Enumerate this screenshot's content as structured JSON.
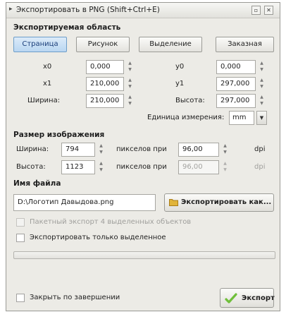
{
  "window": {
    "title": "Экспортировать в PNG (Shift+Ctrl+E)"
  },
  "export_area": {
    "heading": "Экспортируемая область",
    "tabs": [
      {
        "label": "Страница",
        "active": true
      },
      {
        "label": "Рисунок",
        "active": false
      },
      {
        "label": "Выделение",
        "active": false
      },
      {
        "label": "Заказная",
        "active": false
      }
    ],
    "x0_label": "x0",
    "x0_value": "0,000",
    "y0_label": "y0",
    "y0_value": "0,000",
    "x1_label": "x1",
    "x1_value": "210,000",
    "y1_label": "y1",
    "y1_value": "297,000",
    "width_label": "Ширина:",
    "width_value": "210,000",
    "height_label": "Высота:",
    "height_value": "297,000",
    "units_label": "Единица измерения:",
    "units_value": "mm"
  },
  "image_size": {
    "heading": "Размер изображения",
    "width_label": "Ширина:",
    "width_value": "794",
    "height_label": "Высота:",
    "height_value": "1123",
    "pixels_at_label": "пикселов при",
    "dpi_value": "96,00",
    "dpi_value_dim": "96,00",
    "dpi_label": "dpi"
  },
  "filename": {
    "heading": "Имя файла",
    "value": "D:\\Логотип Давыдова.png",
    "export_as_label": "Экспортировать как..."
  },
  "options": {
    "batch_label": "Пакетный экспорт 4 выделенных объектов",
    "only_selected_label": "Экспортировать только выделенное",
    "close_label": "Закрыть по завершении"
  },
  "progress_value": 0.0,
  "export_button_label": "Экспорт",
  "colors": {
    "active_tab": "#b9d6f1",
    "export_icon": "#6fbf3a",
    "folder_icon": "#e1b43a"
  }
}
